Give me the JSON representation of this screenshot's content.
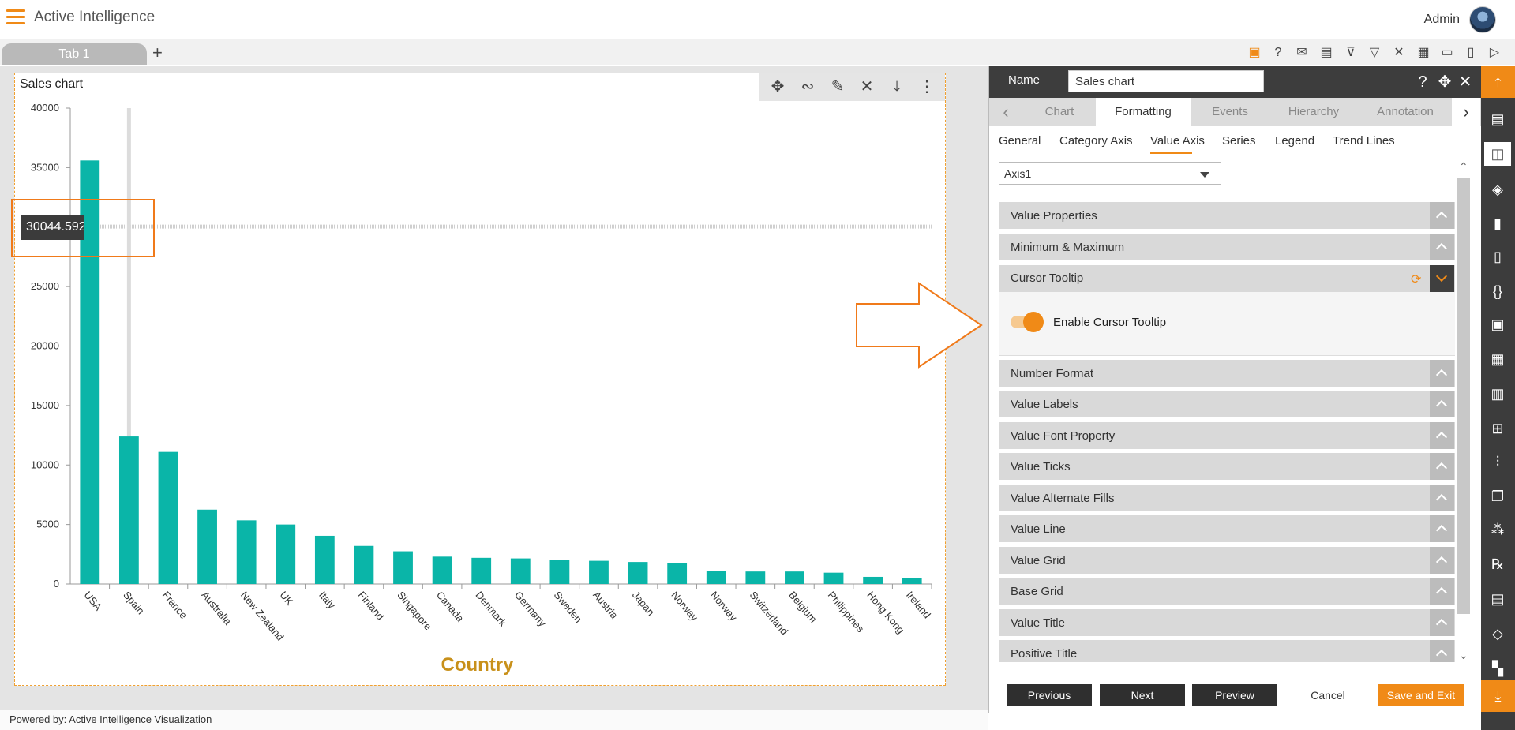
{
  "app": {
    "title": "Active Intelligence",
    "user": "Admin"
  },
  "tabs": {
    "active": "Tab 1",
    "add": "+"
  },
  "toolbar_icons": [
    "save-icon",
    "help-icon",
    "mail-icon",
    "comment-icon",
    "clear-filter-icon",
    "filter-icon",
    "tools-icon",
    "table-icon",
    "embed-icon",
    "devices-icon",
    "play-icon"
  ],
  "widget": {
    "title": "Sales chart",
    "tools": [
      "move-icon",
      "link-icon",
      "edit-icon",
      "settings-icon",
      "download-icon",
      "more-icon"
    ]
  },
  "chart_data": {
    "type": "bar",
    "title": "Sales chart",
    "xlabel": "Country",
    "ylabel": "",
    "ylim": [
      0,
      40000
    ],
    "yticks": [
      0,
      5000,
      10000,
      15000,
      20000,
      25000,
      30000,
      35000,
      40000
    ],
    "categories": [
      "USA",
      "Spain",
      "France",
      "Australia",
      "New Zealand",
      "UK",
      "Italy",
      "Finland",
      "Singapore",
      "Canada",
      "Denmark",
      "Germany",
      "Sweden",
      "Austria",
      "Japan",
      "Norway",
      "Norway",
      "Switzerland",
      "Belgium",
      "Philippines",
      "Hong Kong",
      "Ireland"
    ],
    "values": [
      35600,
      12400,
      11100,
      6250,
      5350,
      5000,
      4050,
      3200,
      2750,
      2300,
      2200,
      2150,
      2000,
      1950,
      1850,
      1750,
      1100,
      1050,
      1050,
      950,
      600,
      500
    ],
    "color": "#0ab5a8",
    "xlabel_color": "#c8901a",
    "cursor_value": "30044.592",
    "grid": false
  },
  "panel": {
    "name_label": "Name",
    "name_value": "Sales chart",
    "tabs": [
      "Chart",
      "Formatting",
      "Events",
      "Hierarchy",
      "Annotation"
    ],
    "active_tab": "Formatting",
    "subtabs": [
      "General",
      "Category Axis",
      "Value Axis",
      "Series",
      "Legend",
      "Trend Lines"
    ],
    "active_subtab": "Value Axis",
    "axis_select": "Axis1",
    "sections": [
      "Value Properties",
      "Minimum & Maximum",
      "Cursor Tooltip",
      "Number Format",
      "Value Labels",
      "Value Font Property",
      "Value Ticks",
      "Value Alternate Fills",
      "Value Line",
      "Value Grid",
      "Base Grid",
      "Value Title",
      "Positive Title"
    ],
    "expanded_section": "Cursor Tooltip",
    "toggle_label": "Enable Cursor Tooltip",
    "toggle_on": true,
    "buttons": {
      "previous": "Previous",
      "next": "Next",
      "preview": "Preview",
      "cancel": "Cancel",
      "save": "Save and Exit"
    }
  },
  "footer": {
    "powered_by": "Powered by: Active Intelligence Visualization"
  },
  "accent_color": "#f08a17"
}
